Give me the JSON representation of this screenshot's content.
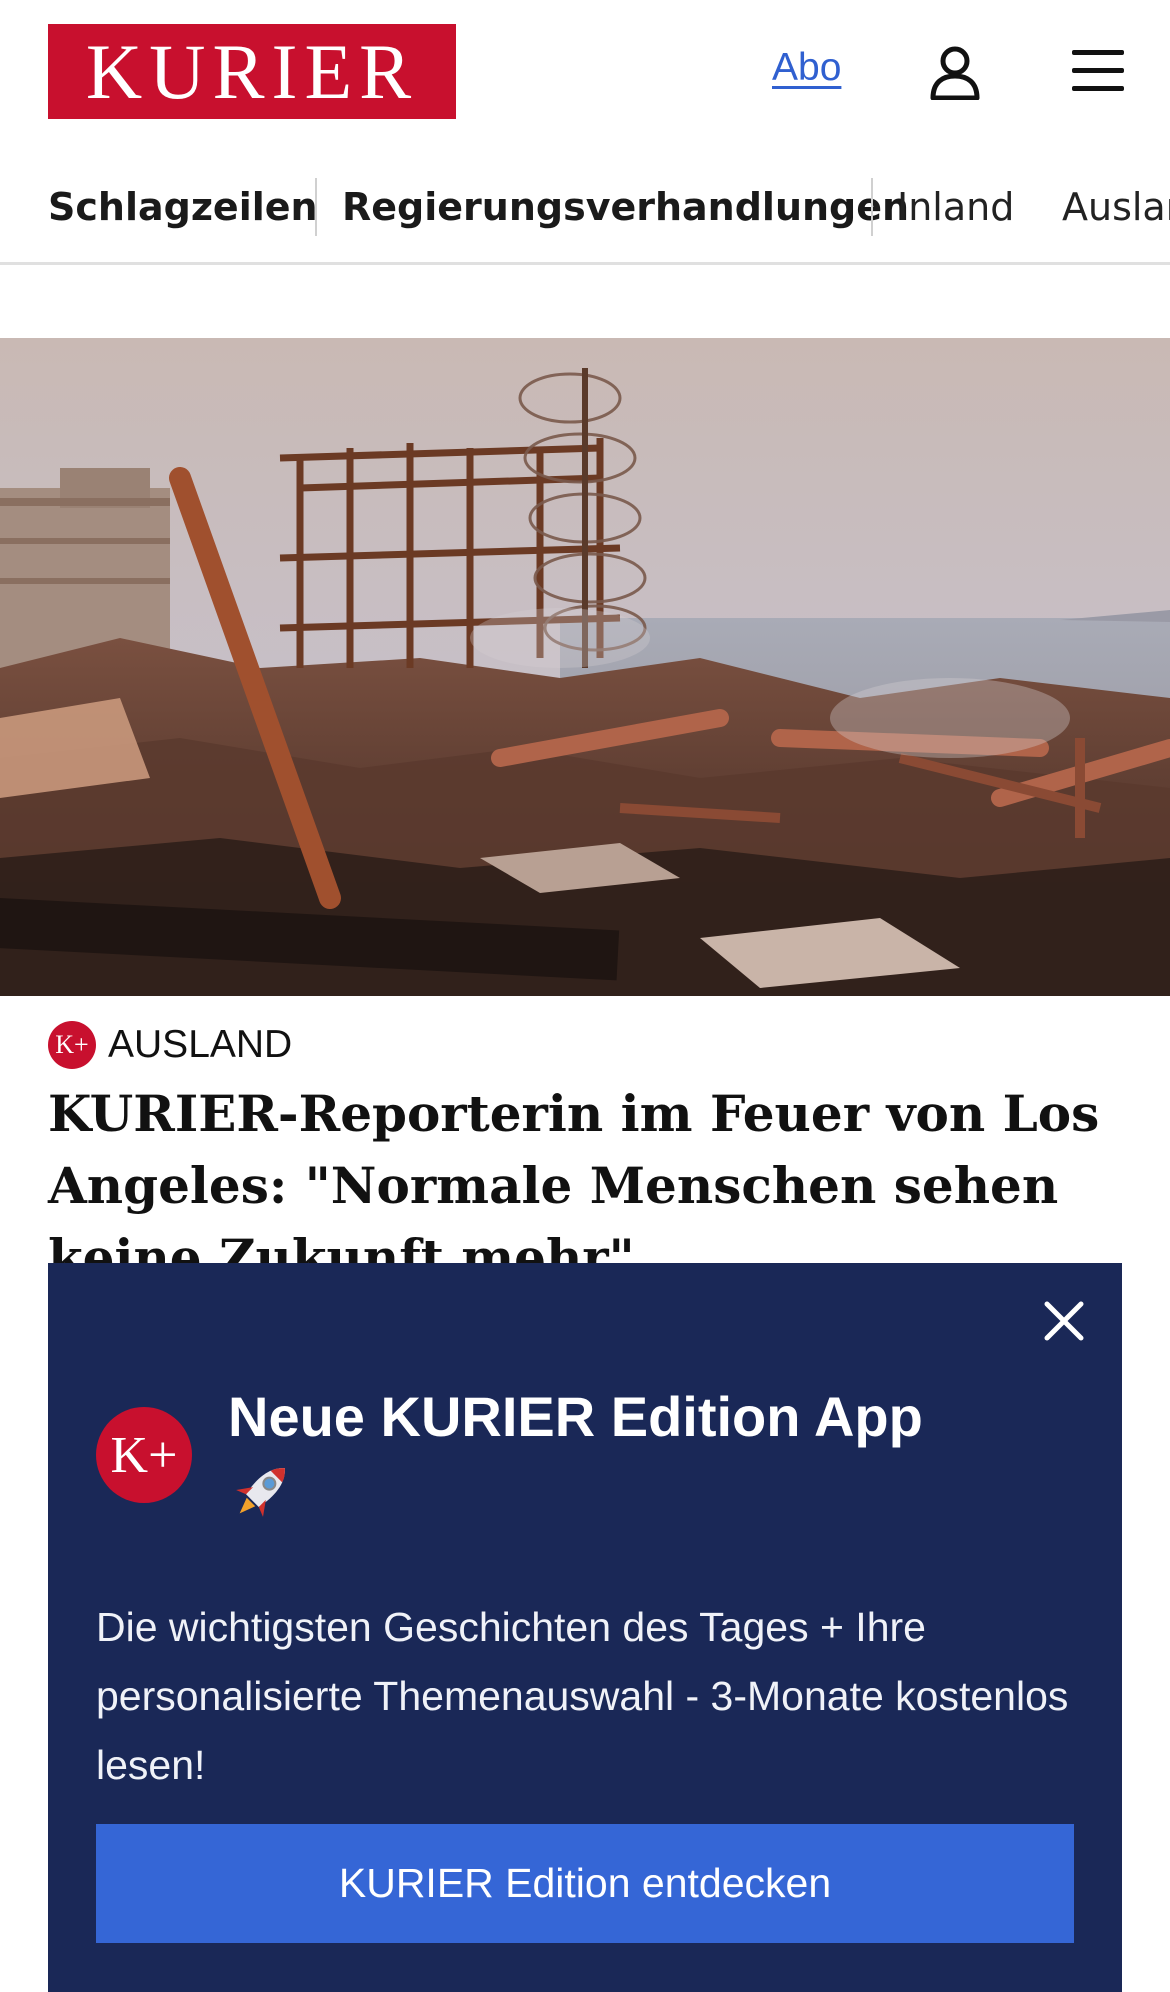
{
  "header": {
    "logo_text": "KURIER",
    "abo_label": "Abo",
    "user_icon": "user-icon",
    "menu_icon": "hamburger-menu-icon",
    "brand_color": "#c8102e"
  },
  "nav": {
    "items": [
      {
        "label": "Schlagzeilen",
        "active": true
      },
      {
        "label": "Regierungsverhandlungen"
      },
      {
        "label": "Inland"
      },
      {
        "label": "Ausland"
      }
    ]
  },
  "article": {
    "badge": "K+",
    "category": "AUSLAND",
    "headline": "KURIER-Reporterin im Feuer von Los Angeles: \"Normale Menschen sehen keine Zukunft mehr\""
  },
  "promo": {
    "badge": "K+",
    "title": "Neue KURIER Edition App",
    "emoji_icon": "rocket-icon",
    "text": "Die wichtigsten Geschichten des Tages + Ihre personalisierte Themenauswahl - 3-Monate kostenlos lesen!",
    "cta_label": "KURIER Edition entdecken",
    "close_icon": "close-icon",
    "background_color": "#1a2857",
    "cta_color": "#3566d6"
  }
}
